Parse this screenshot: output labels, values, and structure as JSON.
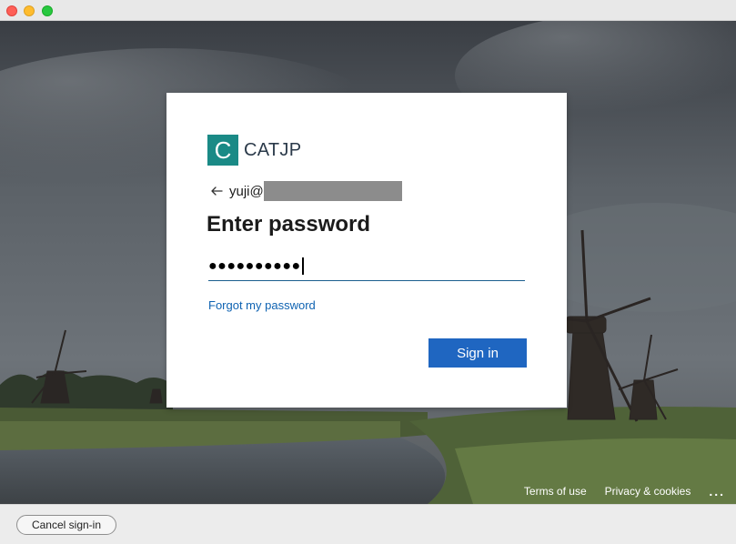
{
  "brand": {
    "logo_letter": "C",
    "name": "CATJP",
    "color": "#1a8a86"
  },
  "identity": {
    "username_visible": "yuji@",
    "back_icon": "back-arrow-icon"
  },
  "page": {
    "title": "Enter password"
  },
  "password": {
    "masked_value": "●●●●●●●●●●"
  },
  "links": {
    "forgot": "Forgot my password"
  },
  "buttons": {
    "sign_in": "Sign in",
    "cancel": "Cancel sign-in"
  },
  "footer": {
    "terms": "Terms of use",
    "privacy": "Privacy & cookies",
    "more": "..."
  },
  "colors": {
    "accent": "#1f66c1",
    "link": "#0f63b2"
  }
}
